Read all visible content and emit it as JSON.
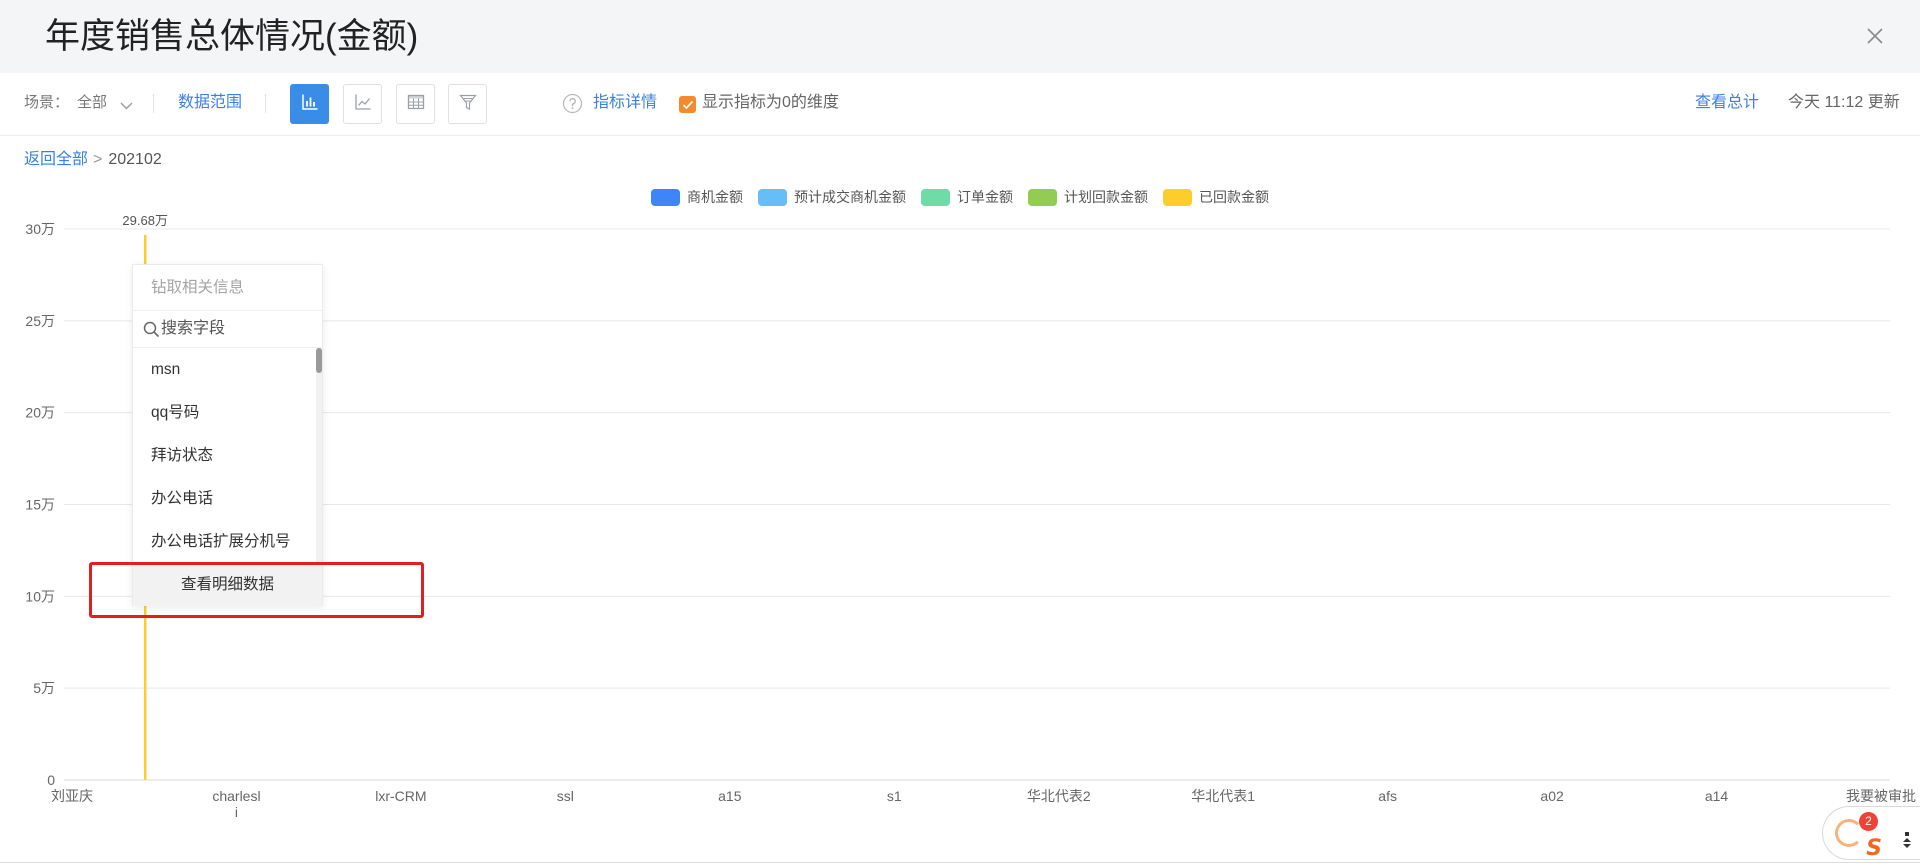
{
  "header": {
    "title": "年度销售总体情况(金额)",
    "close_icon": "close-icon"
  },
  "toolbar": {
    "scene_label": "场景：",
    "scene_value": "全部",
    "data_range": "数据范围",
    "views": [
      "bar-chart-icon",
      "line-chart-icon",
      "table-icon",
      "funnel-icon"
    ],
    "active_view": "bar-chart-icon",
    "help_icon": "question-circle-icon",
    "metric_detail": "指标详情",
    "show_zero_checked": true,
    "show_zero_label": "显示指标为0的维度",
    "view_total": "查看总计",
    "update_time": "今天 11:12 更新"
  },
  "breadcrumb": {
    "back": "返回全部",
    "separator": ">",
    "current": "202102"
  },
  "drill_menu": {
    "title": "钻取相关信息",
    "search_icon": "search-icon",
    "search_placeholder": "搜索字段",
    "items": [
      "msn",
      "qq号码",
      "拜访状态",
      "办公电话",
      "办公电话扩展分机号"
    ],
    "detail_button": "查看明细数据"
  },
  "float_widget": {
    "badge": "2",
    "logo_text": "S"
  },
  "colors": {
    "accent": "#3b7fe6",
    "active_button": "#3a8de6",
    "checkbox": "#f5892c",
    "highlight_border": "#e0201e",
    "badge": "#f04134"
  },
  "chart_data": {
    "type": "bar",
    "categories": [
      "刘亚庆",
      "charlesli",
      "lxr-CRM",
      "ssl",
      "a15",
      "s1",
      "华北代表2",
      "华北代表1",
      "afs",
      "a02",
      "a14",
      "我要被审批"
    ],
    "series": [
      {
        "name": "商机金额",
        "color": "#3d86f7",
        "values": [
          0,
          0,
          0,
          0,
          0,
          0,
          0,
          0,
          0,
          0,
          0,
          0
        ]
      },
      {
        "name": "预计成交商机金额",
        "color": "#66bdf8",
        "values": [
          0,
          0,
          0,
          0,
          0,
          0,
          0,
          0,
          0,
          0,
          0,
          0
        ]
      },
      {
        "name": "订单金额",
        "color": "#6edca6",
        "values": [
          0,
          0,
          0,
          0,
          0,
          0,
          0,
          0,
          0,
          0,
          0,
          0
        ]
      },
      {
        "name": "计划回款金额",
        "color": "#93cc52",
        "values": [
          0,
          0,
          0,
          0,
          0,
          0,
          0,
          0,
          0,
          0,
          0,
          0
        ]
      },
      {
        "name": "已回款金额",
        "color": "#fccd2c",
        "values": [
          29.68,
          0,
          0,
          0,
          0,
          0,
          0,
          0,
          0,
          0,
          0,
          0
        ]
      }
    ],
    "ylim": [
      0,
      30
    ],
    "ystep": 5,
    "yticks": [
      "0",
      "5万",
      "10万",
      "15万",
      "20万",
      "25万",
      "30万"
    ],
    "data_labels": [
      {
        "series": 4,
        "category": 0,
        "text": "29.68万"
      }
    ],
    "legend_position": "top-center",
    "grid": true,
    "xlabel": "",
    "ylabel": ""
  }
}
